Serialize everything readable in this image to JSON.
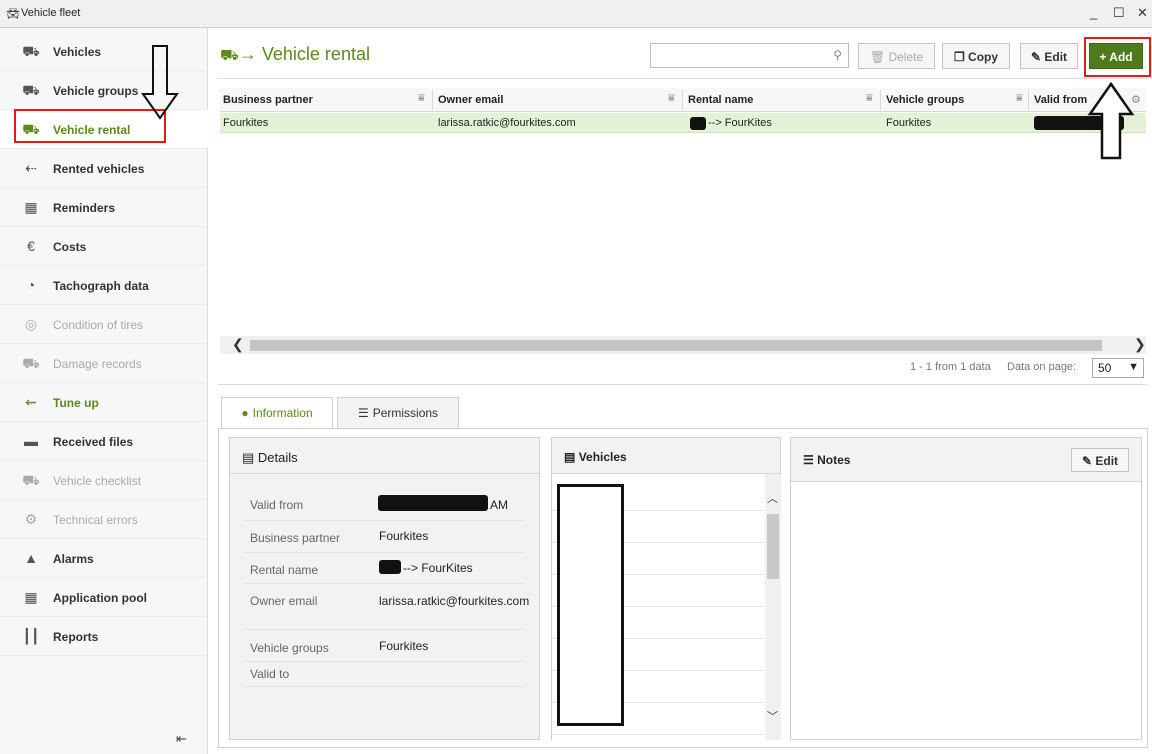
{
  "window": {
    "title": "Vehicle fleet",
    "min": "_",
    "max": "☐",
    "close": "✕"
  },
  "sidebar": {
    "items": [
      {
        "label": "Vehicles",
        "icon": "car-group-icon"
      },
      {
        "label": "Vehicle groups",
        "icon": "vehicle-groups-icon"
      },
      {
        "label": "Vehicle rental",
        "icon": "car-arrow-icon"
      },
      {
        "label": "Rented vehicles",
        "icon": "car-back-arrow-icon"
      },
      {
        "label": "Reminders",
        "icon": "calendar-icon"
      },
      {
        "label": "Costs",
        "icon": "euro-icon"
      },
      {
        "label": "Tachograph data",
        "icon": "gauge-icon"
      },
      {
        "label": "Condition of tires",
        "icon": "tire-icon"
      },
      {
        "label": "Damage records",
        "icon": "damaged-car-icon"
      },
      {
        "label": "Tune up",
        "icon": "tune-up-icon"
      },
      {
        "label": "Received files",
        "icon": "folder-icon"
      },
      {
        "label": "Vehicle checklist",
        "icon": "checklist-car-icon"
      },
      {
        "label": "Technical errors",
        "icon": "engine-error-icon"
      },
      {
        "label": "Alarms",
        "icon": "bell-icon"
      },
      {
        "label": "Application pool",
        "icon": "grid-icon"
      },
      {
        "label": "Reports",
        "icon": "bar-chart-icon"
      }
    ],
    "collapse": "⇤"
  },
  "header": {
    "title": "Vehicle rental",
    "title_icon": "→",
    "search_placeholder": "",
    "buttons": {
      "delete": "Delete",
      "copy": "Copy",
      "edit": "Edit",
      "add": "+ Add"
    }
  },
  "grid": {
    "columns": [
      "Business partner",
      "Owner email",
      "Rental name",
      "Vehicle groups",
      "Valid from"
    ],
    "rows": [
      {
        "business_partner": "Fourkites",
        "owner_email": "larissa.ratkic@fourkites.com",
        "rental_name": "--> FourKites",
        "vehicle_groups": "Fourkites",
        "valid_from": ""
      }
    ],
    "pager_info": "1 - 1 from 1 data",
    "pager_label": "Data on page:",
    "page_size": "50"
  },
  "tabs": {
    "information": "Information",
    "permissions": "Permissions"
  },
  "details": {
    "title": "Details",
    "fields": [
      {
        "label": "Valid from",
        "value": "AM"
      },
      {
        "label": "Business partner",
        "value": "Fourkites"
      },
      {
        "label": "Rental name",
        "value": "--> FourKites"
      },
      {
        "label": "Owner email",
        "value": "larissa.ratkic@fourkites.com"
      },
      {
        "label": "Vehicle groups",
        "value": "Fourkites"
      },
      {
        "label": "Valid to",
        "value": ""
      }
    ]
  },
  "vehicles_panel": {
    "title": "Vehicles"
  },
  "notes_panel": {
    "title": "Notes",
    "edit": "Edit"
  },
  "colors": {
    "accent": "#5a8a1a",
    "add_button": "#4d7b1e",
    "selected_row": "#e3f2d5",
    "highlight": "#e41b1b"
  }
}
